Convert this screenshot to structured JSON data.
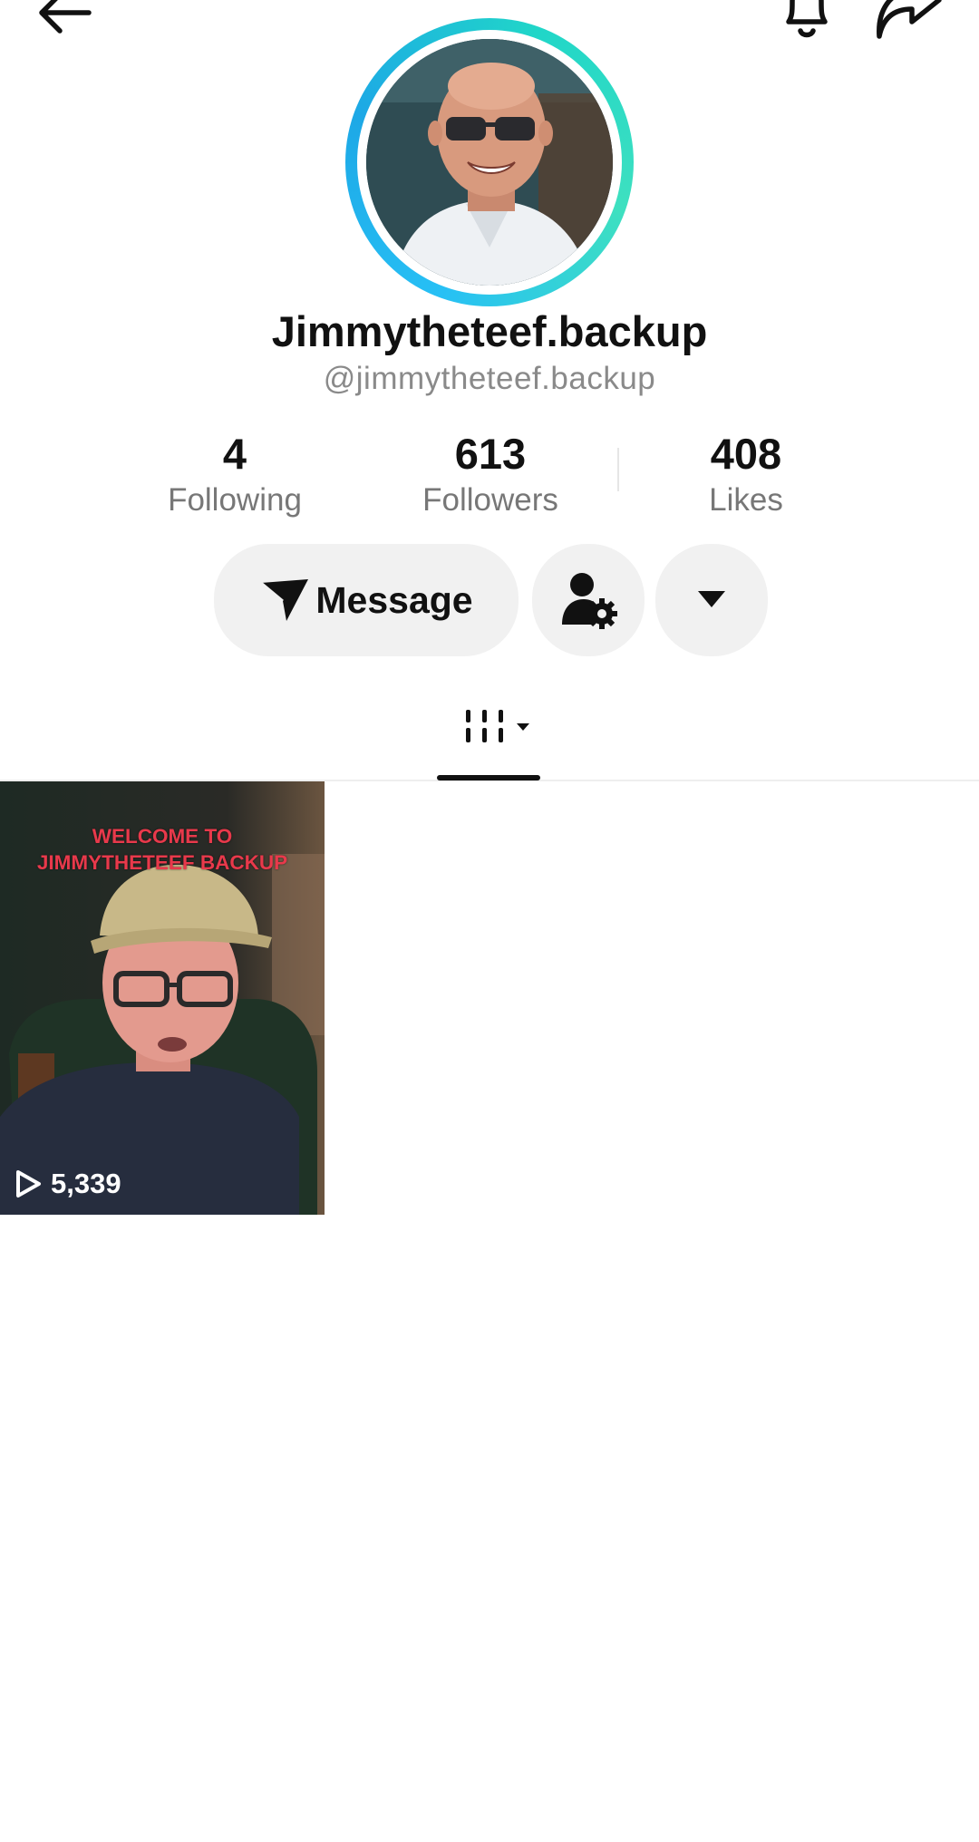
{
  "header": {
    "back_icon": "arrow-left-icon",
    "bell_icon": "bell-icon",
    "share_icon": "share-arrow-icon"
  },
  "profile": {
    "display_name": "Jimmytheteef.backup",
    "username": "@jimmytheteef.backup",
    "ring_colors": [
      "#27c0f5",
      "#3ee0c0"
    ]
  },
  "stats": [
    {
      "value": "4",
      "label": "Following"
    },
    {
      "value": "613",
      "label": "Followers"
    },
    {
      "value": "408",
      "label": "Likes"
    }
  ],
  "actions": {
    "message_label": "Message",
    "message_icon": "send-icon",
    "user_settings_icon": "user-gear-icon",
    "more_icon": "caret-down-icon"
  },
  "tabs": {
    "active": "videos-grid",
    "icon": "grid-columns-icon"
  },
  "videos": [
    {
      "title": "WELCOME TO\nJIMMYTHETEEF BACKUP",
      "views": "5,339",
      "title_color": "#e8394b"
    }
  ]
}
